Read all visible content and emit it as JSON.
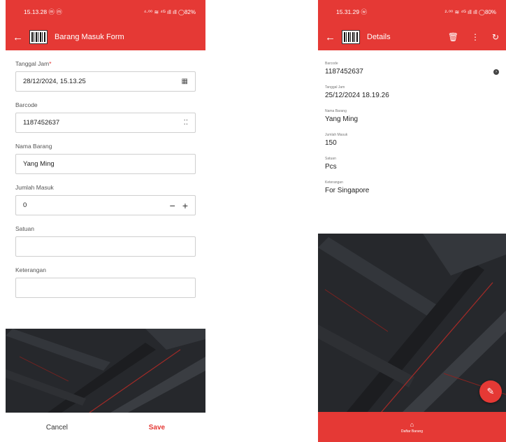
{
  "left": {
    "status": {
      "time": "15.13.28 ⓜ ⓜ",
      "indicators": "⁴·⁰⁰ ≋ ⁴ᴳ ıll ıll ◯82%"
    },
    "appbar": {
      "title": "Barang Masuk Form",
      "back_icon": "←"
    },
    "form": {
      "tanggal": {
        "label": "Tanggal Jam",
        "required": "*",
        "value": "28/12/2024, 15.13.25",
        "icon": "▦"
      },
      "barcode": {
        "label": "Barcode",
        "value": "1187452637",
        "icon": "⁚⁚"
      },
      "nama": {
        "label": "Nama Barang",
        "value": "Yang Ming"
      },
      "jumlah": {
        "label": "Jumlah Masuk",
        "value": "0",
        "minus": "−",
        "plus": "+"
      },
      "satuan": {
        "label": "Satuan",
        "value": ""
      },
      "keterangan": {
        "label": "Keterangan",
        "value": ""
      }
    },
    "footer": {
      "cancel": "Cancel",
      "save": "Save"
    }
  },
  "right": {
    "status": {
      "time": "15.31.29 ⓦ",
      "indicators": "²·⁰⁰ ≋ ⁴ᴳ ıll ıll ◯80%"
    },
    "appbar": {
      "title": "Details",
      "back_icon": "←",
      "delete_icon": "🗑",
      "more_icon": "⋮",
      "refresh_icon": "↻"
    },
    "details": [
      {
        "label": "Barcode",
        "value": "1187452637"
      },
      {
        "label": "Tanggal Jam",
        "value": "25/12/2024 18.19.26"
      },
      {
        "label": "Nama Barang",
        "value": "Yang Ming"
      },
      {
        "label": "Jumlah Masuk",
        "value": "150"
      },
      {
        "label": "Satuan",
        "value": "Pcs"
      },
      {
        "label": "Keterangan",
        "value": "For Singapore"
      }
    ],
    "fab_icon": "✎",
    "bottomnav": {
      "icon": "⌂",
      "label": "Daftar Barang"
    }
  },
  "colors": {
    "accent": "#e53935",
    "dark_bg": "#26282c"
  }
}
